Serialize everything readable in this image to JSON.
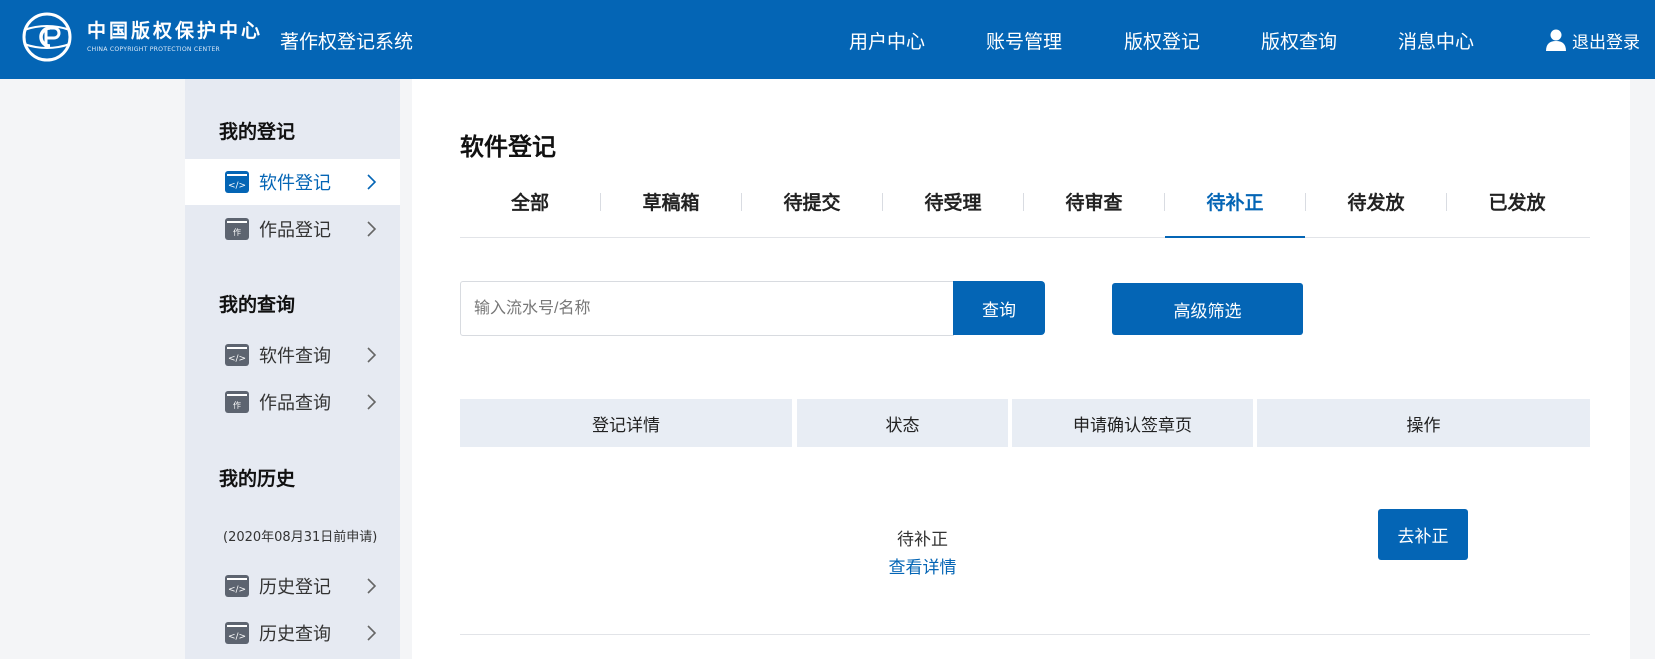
{
  "header": {
    "org_name_cn": "中国版权保护中心",
    "org_name_en": "CHINA COPYRIGHT PROTECTION CENTER",
    "system_name": "著作权登记系统",
    "nav": [
      "用户中心",
      "账号管理",
      "版权登记",
      "版权查询",
      "消息中心"
    ],
    "logout_label": "退出登录"
  },
  "sidebar": {
    "sections": [
      {
        "heading": "我的登记"
      },
      {
        "heading": "我的查询"
      },
      {
        "heading": "我的历史",
        "subheading": "(2020年08月31日前申请)"
      }
    ],
    "items": [
      {
        "label": "软件登记",
        "icon": "software-code-icon",
        "active": true
      },
      {
        "label": "作品登记",
        "icon": "work-document-icon",
        "active": false
      },
      {
        "label": "软件查询",
        "icon": "software-code-icon",
        "active": false
      },
      {
        "label": "作品查询",
        "icon": "work-document-icon",
        "active": false
      },
      {
        "label": "历史登记",
        "icon": "software-code-icon",
        "active": false
      },
      {
        "label": "历史查询",
        "icon": "software-code-icon",
        "active": false
      }
    ]
  },
  "main": {
    "title": "软件登记",
    "tabs": [
      "全部",
      "草稿箱",
      "待提交",
      "待受理",
      "待审查",
      "待补正",
      "待发放",
      "已发放"
    ],
    "active_tab": "待补正",
    "search": {
      "placeholder": "输入流水号/名称",
      "value": "",
      "button_label": "查询"
    },
    "advanced_filter_label": "高级筛选",
    "table": {
      "headers": [
        "登记详情",
        "状态",
        "申请确认签章页",
        "操作"
      ],
      "rows": [
        {
          "status": "待补正",
          "detail_link": "查看详情",
          "action_label": "去补正"
        }
      ]
    }
  },
  "colors": {
    "primary": "#0465b5",
    "sidebar_bg": "#e6eaf2",
    "table_header_bg": "#e8edf4"
  }
}
